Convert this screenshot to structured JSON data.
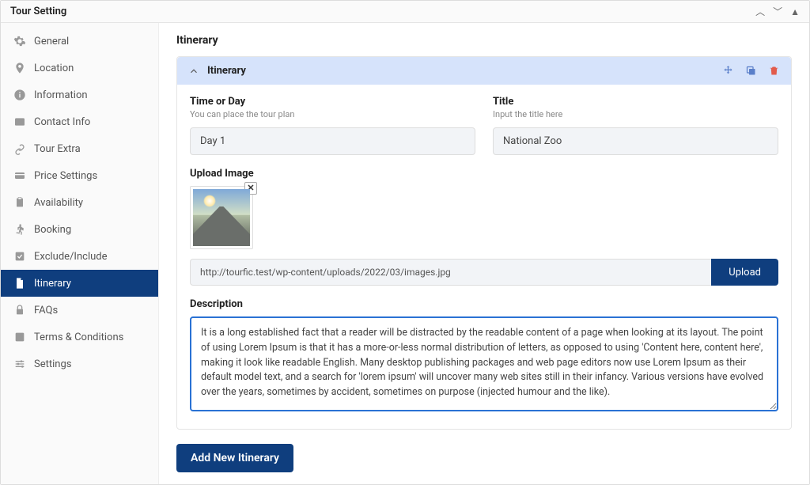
{
  "panel": {
    "title": "Tour Setting"
  },
  "sidebar": {
    "items": [
      {
        "label": "General"
      },
      {
        "label": "Location"
      },
      {
        "label": "Information"
      },
      {
        "label": "Contact Info"
      },
      {
        "label": "Tour Extra"
      },
      {
        "label": "Price Settings"
      },
      {
        "label": "Availability"
      },
      {
        "label": "Booking"
      },
      {
        "label": "Exclude/Include"
      },
      {
        "label": "Itinerary"
      },
      {
        "label": "FAQs"
      },
      {
        "label": "Terms & Conditions"
      },
      {
        "label": "Settings"
      }
    ]
  },
  "section": {
    "title": "Itinerary"
  },
  "card": {
    "title": "Itinerary"
  },
  "fields": {
    "time": {
      "label": "Time or Day",
      "hint": "You can place the tour plan",
      "value": "Day 1"
    },
    "title": {
      "label": "Title",
      "hint": "Input the title here",
      "value": "National Zoo"
    },
    "upload": {
      "label": "Upload Image",
      "path": "http://tourfic.test/wp-content/uploads/2022/03/images.jpg",
      "button": "Upload"
    },
    "description": {
      "label": "Description",
      "value": "It is a long established fact that a reader will be distracted by the readable content of a page when looking at its layout. The point of using Lorem Ipsum is that it has a more-or-less normal distribution of letters, as opposed to using 'Content here, content here', making it look like readable English. Many desktop publishing packages and web page editors now use Lorem Ipsum as their default model text, and a search for 'lorem ipsum' will uncover many web sites still in their infancy. Various versions have evolved over the years, sometimes by accident, sometimes on purpose (injected humour and the like)."
    }
  },
  "buttons": {
    "add": "Add New Itinerary"
  }
}
